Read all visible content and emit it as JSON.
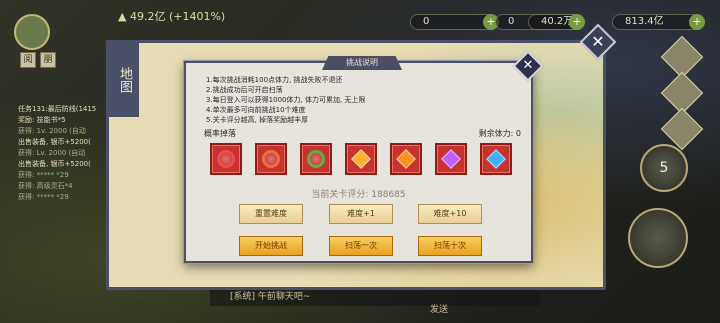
{
  "hud": {
    "power_gain": "49.2亿 (+1401%)",
    "resources": [
      "0",
      "0",
      "40.2万",
      "813.4亿"
    ],
    "side_buttons": [
      "阅",
      "朋"
    ],
    "right_badge": "5"
  },
  "quest_log": [
    {
      "text": "任务131:最后防线(1415",
      "dim": false
    },
    {
      "text": "奖励: 技能书*5",
      "dim": false
    },
    {
      "text": "获得: 1v. 2000 (自动",
      "dim": true
    },
    {
      "text": "出售装备, 银币+5200(",
      "dim": false
    },
    {
      "text": "获得: Lv. 2000 (自动",
      "dim": true
    },
    {
      "text": "出售装备, 银币+5200(",
      "dim": false
    },
    {
      "text": "获得: ***** *29",
      "dim": true
    },
    {
      "text": "获得: 高级灵石*4",
      "dim": true
    },
    {
      "text": "获得: ***** *29",
      "dim": true
    }
  ],
  "map_panel": {
    "tab_label": "地图",
    "close_glyph": "✕"
  },
  "dialog": {
    "title": "挑战说明",
    "close_glyph": "✕",
    "rules": [
      "1.每次挑战消耗100点体力, 挑战失败不退还",
      "2.挑战成功后可开启扫荡",
      "3.每日登入可以获得1000体力, 体力可累加, 无上限",
      "4.单次最多可向前挑战10个难度",
      "5.关卡评分越高, 掉落奖励越丰厚"
    ],
    "drop_label": "概率掉落",
    "stamina_label": "剩余体力:",
    "stamina_value": "0",
    "drop_items": [
      {
        "icon": "fire-orb-icon",
        "kind": "ring",
        "color": "#f04a50"
      },
      {
        "icon": "earth-orb-icon",
        "kind": "ring",
        "color": "#e87040"
      },
      {
        "icon": "leaf-orb-icon",
        "kind": "ring",
        "color": "#60b040"
      },
      {
        "icon": "orange-gem-icon",
        "kind": "gem",
        "color": "#ffb030"
      },
      {
        "icon": "amber-gem-icon",
        "kind": "gem",
        "color": "#ff9020"
      },
      {
        "icon": "purple-gem-icon",
        "kind": "gem",
        "color": "#c060ff"
      },
      {
        "icon": "blue-gem-icon",
        "kind": "gem",
        "color": "#40b0ff"
      }
    ],
    "score_label": "当前关卡评分:",
    "score_value": "188685",
    "buttons": {
      "reset_difficulty": "重置难度",
      "difficulty_plus_1": "难度+1",
      "difficulty_plus_10": "难度+10",
      "start_challenge": "开始挑战",
      "sweep_once": "扫荡一次",
      "sweep_ten": "扫荡十次"
    }
  },
  "chat": {
    "placeholder": "[系统]  午前聊天吧~",
    "send_label": "发送"
  }
}
